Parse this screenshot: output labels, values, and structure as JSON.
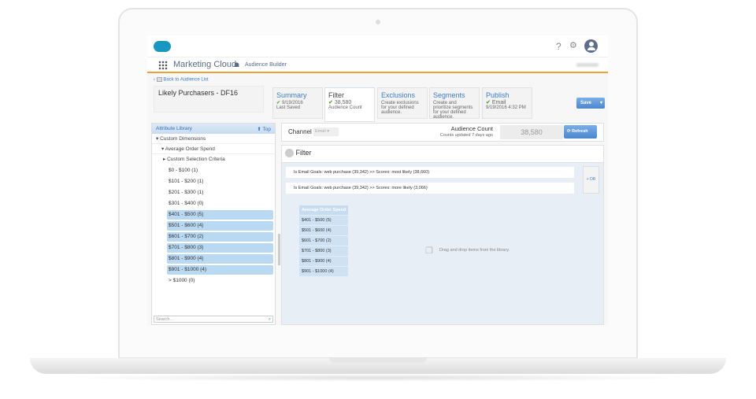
{
  "header": {
    "app_name": "Marketing Cloud",
    "module": "Audience Builder",
    "help_icon": "?",
    "back_link": "Back to Audience List"
  },
  "audience": {
    "title": "Likely Purchasers - DF16"
  },
  "tabs": [
    {
      "label": "Summary",
      "line1": "9/19/2016",
      "line2": "Last Saved",
      "check": true
    },
    {
      "label": "Filter",
      "line1": "38,580",
      "line2": "Audience Count",
      "check": true
    },
    {
      "label": "Exclusions",
      "desc": "Create exclusions for your defined audience."
    },
    {
      "label": "Segments",
      "desc": "Create and prioritize segments for your defined audience."
    },
    {
      "label": "Publish",
      "line1": "Email",
      "line2": "9/19/2016 4:32 PM",
      "check": true
    }
  ],
  "save_label": "Save",
  "library": {
    "title": "Attribute Library",
    "top_label": "Top",
    "dimension": "Custom Dimensions",
    "attribute": "Average Order Spend",
    "criteria": "Custom Selection Criteria",
    "options": [
      {
        "label": "$0 - $100 (1)",
        "selected": false
      },
      {
        "label": "$101 - $200 (1)",
        "selected": false
      },
      {
        "label": "$201 - $300 (1)",
        "selected": false
      },
      {
        "label": "$301 - $400 (0)",
        "selected": false
      },
      {
        "label": "$401 - $500 (5)",
        "selected": true
      },
      {
        "label": "$501 - $600 (4)",
        "selected": true
      },
      {
        "label": "$601 - $700 (2)",
        "selected": true
      },
      {
        "label": "$701 - $800 (3)",
        "selected": true
      },
      {
        "label": "$801 - $900 (4)",
        "selected": true
      },
      {
        "label": "$901 - $1000 (4)",
        "selected": true
      },
      {
        "label": "> $1000 (0)",
        "selected": false
      }
    ],
    "search_placeholder": "Search..."
  },
  "channel": {
    "label": "Channel",
    "value": "Email"
  },
  "count": {
    "label": "Audience Count",
    "updated": "Counts updated 7 days ago",
    "value": "38,580",
    "refresh": "Refresh"
  },
  "filter": {
    "title": "Filter",
    "criteria": [
      "Is  Email Goals: web purchase (39,342) >> Scores: most likely (38,660)",
      "Is  Email Goals: web purchase (39,342) >> Scores: more likely (3,066)"
    ],
    "or_label": "+ OR",
    "group_title": "Average Order Spend",
    "group_items": [
      "$401 - $500 (5)",
      "$501 - $600 (4)",
      "$601 - $700 (2)",
      "$701 - $800 (3)",
      "$801 - $900 (4)",
      "$901 - $1000 (4)"
    ],
    "drop_hint": "Drag and drop items from the library."
  },
  "colors": {
    "accent": "#3a7dc9",
    "orange": "#f0a030",
    "selected": "#b9d8f1",
    "brand": "#1798c1"
  }
}
